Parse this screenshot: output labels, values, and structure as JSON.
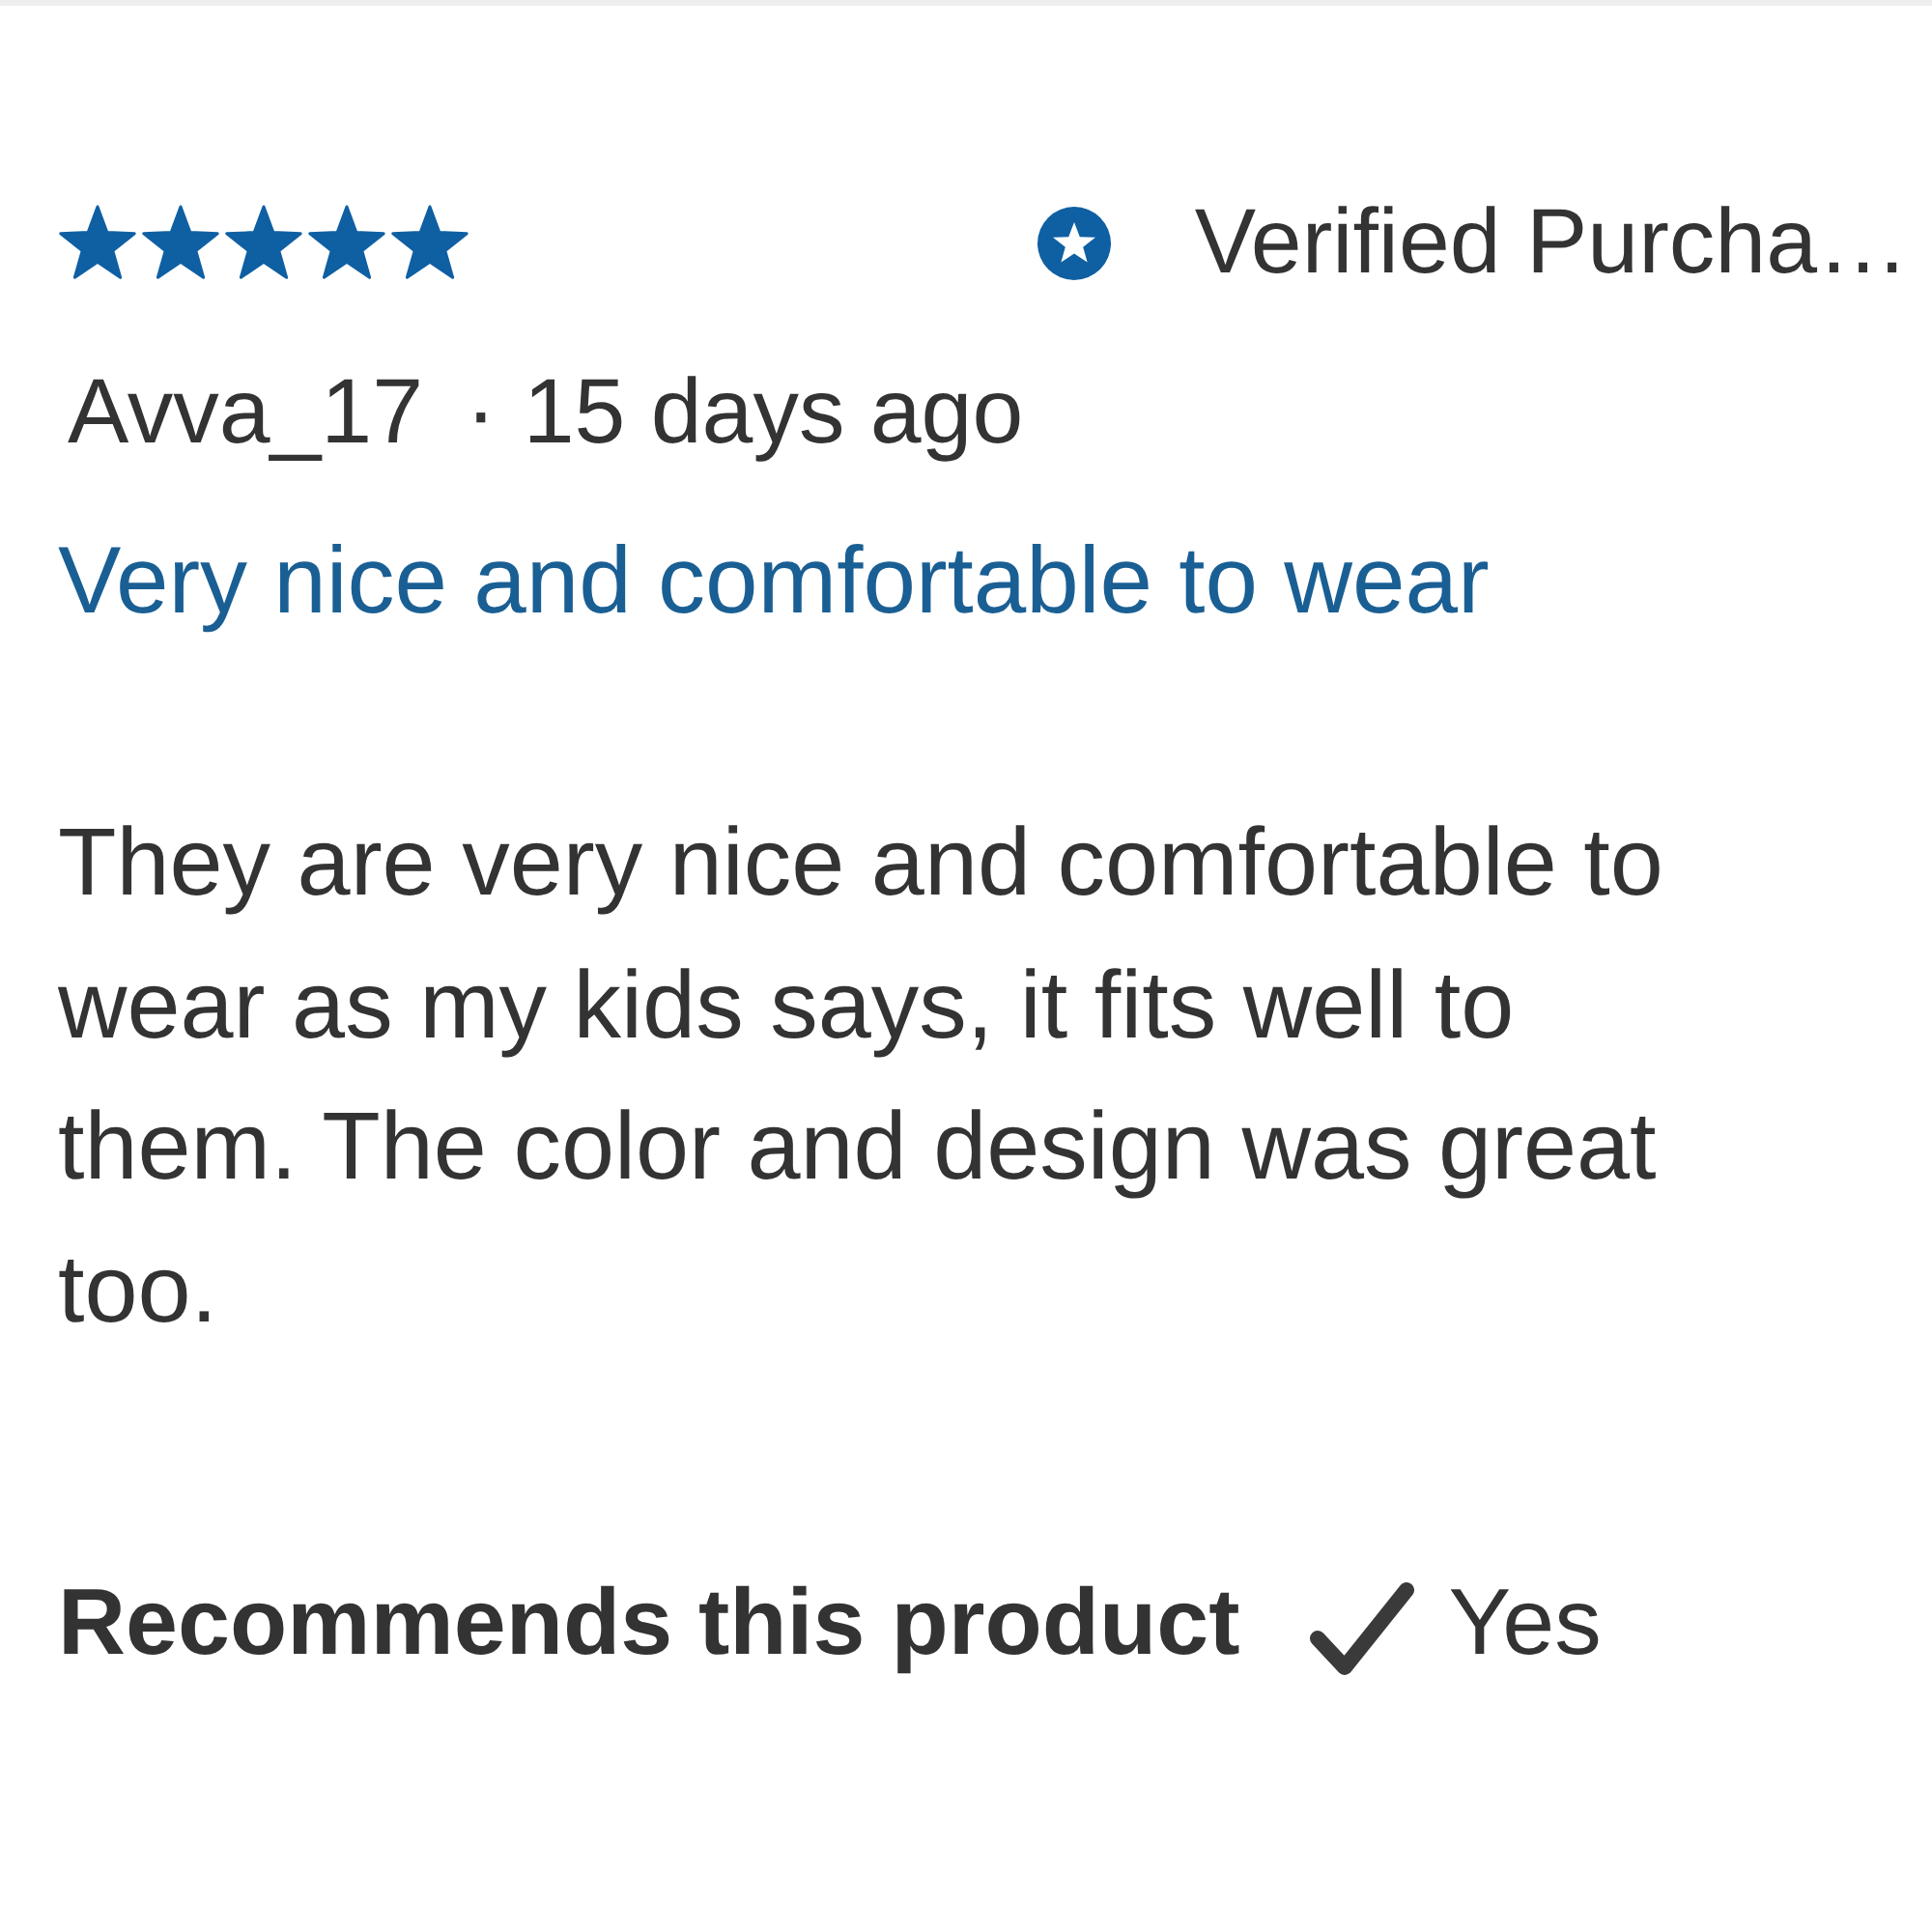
{
  "review": {
    "stars": 5,
    "badge": {
      "label": "Verified Purcha…"
    },
    "author": "Avva_17",
    "separator": "·",
    "date": "15 days ago",
    "title": "Very nice and comfortable to wear",
    "body": "They are very nice and comfortable to wear as my kids says, it fits well to them. The color and design was great too.",
    "recommendation": {
      "label": "Recommends this product",
      "recommended": true,
      "answer": "Yes"
    }
  }
}
